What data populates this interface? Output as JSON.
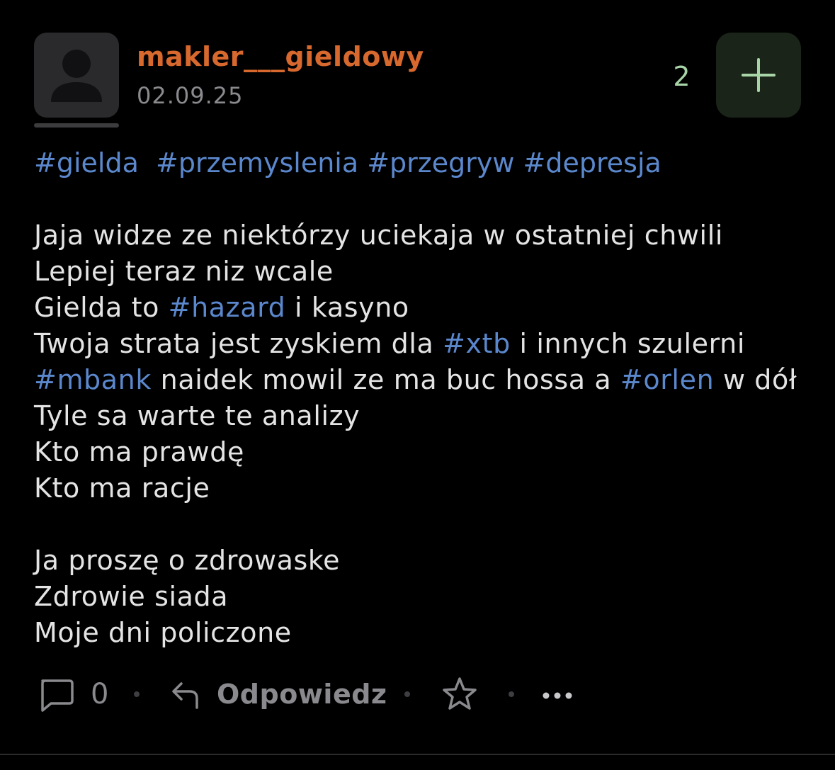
{
  "post": {
    "author": "makler___gieldowy",
    "date": "02.09.25",
    "vote_count": "2",
    "tags": [
      "#gielda",
      "#przemyslenia",
      "#przegryw",
      "#depresja"
    ],
    "lines": {
      "l1": "Jaja widze ze niektórzy uciekaja w ostatniej chwili",
      "l2": "Lepiej teraz niz wcale",
      "l3a": "Gielda to ",
      "l3tag": "#hazard",
      "l3b": " i kasyno",
      "l4a": "Twoja strata jest zyskiem dla ",
      "l4tag": "#xtb",
      "l4b": " i innych szulerni",
      "l5tag1": "#mbank",
      "l5a": " naidek mowil ze ma buc hossa a ",
      "l5tag2": "#orlen",
      "l5b": " w dół",
      "l6": "Tyle sa warte te analizy",
      "l7": "Kto ma prawdę",
      "l8": "Kto ma racje",
      "l9": "Ja proszę o zdrowaske",
      "l10": "Zdrowie siada",
      "l11": "Moje dni policzone"
    }
  },
  "actions": {
    "comment_count": "0",
    "reply_label": "Odpowiedz"
  },
  "icons": {
    "avatar": "user-silhouette-icon",
    "plus": "plus-icon",
    "comment": "comment-bubble-icon",
    "reply": "reply-arrow-icon",
    "star": "star-icon",
    "more": "more-dots-icon"
  },
  "colors": {
    "username": "#d7682e",
    "hashtag": "#5b87cc",
    "vote": "#a8d5a8",
    "plus_button_bg": "#1b2419"
  }
}
